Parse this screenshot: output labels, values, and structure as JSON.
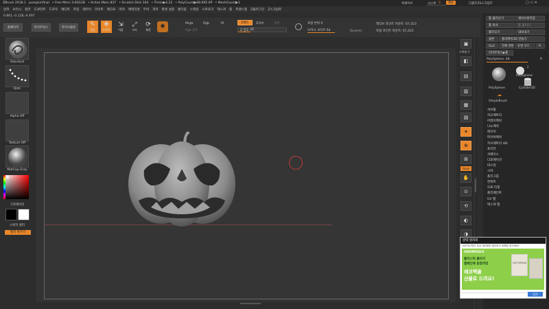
{
  "titlebar": {
    "app": "ZBrush 2018.1",
    "file": "pumpkinfinal",
    "free_mem": "• Free Mem 3.601GB",
    "active_mem": "• Active Mem 837",
    "scratch": "• Scratch Disk 164",
    "timer": "• Timer▶4.22",
    "polycount": "• PolyCount▶68.692 KP",
    "meshcount": "• MeshCount▶1",
    "right_items": [
      "퀵세이브",
      "시스루",
      "메뉴",
      "디폴트ZS스크립트"
    ],
    "seethrough_value": "0"
  },
  "menu": [
    "알파",
    "브러시",
    "컬러",
    "도큐먼트",
    "드로우",
    "에디트",
    "파일",
    "레이어",
    "라이트",
    "매크로",
    "마커",
    "매테리얼",
    "무비",
    "피커",
    "환경 설정",
    "렌더링",
    "스텐실",
    "스트로크",
    "텍스쳐",
    "툴",
    "트랜스폼",
    "Z플러그인",
    "Z스크립트"
  ],
  "coords": "0.861,-0.128,-0.497",
  "toolbar": {
    "home": "홈페이지",
    "lightbox": "라이트박스",
    "livebool": "라이브불린",
    "tools": [
      {
        "label": "편집",
        "icon": "edit-icon",
        "glyph": "✎"
      },
      {
        "label": "드로우",
        "icon": "draw-icon",
        "glyph": "✥"
      },
      {
        "label": "이동",
        "icon": "move-icon",
        "glyph": "⇲"
      },
      {
        "label": "크기",
        "icon": "scale-icon",
        "glyph": "⤢"
      },
      {
        "label": "회전",
        "icon": "rotate-icon",
        "glyph": "⟳"
      }
    ],
    "mrgb": "Mrgb",
    "rgb": "Rgb",
    "m": "M",
    "rgb_intensity": "Rgb 강도",
    "zadd": "Z애드",
    "zsub": "Z서브",
    "zcut": "Z컷",
    "z_intensity_label": "Z 강도",
    "z_intensity": "25",
    "focal_label": "포컬 변위",
    "focal": "0",
    "draw_size_label": "브러시 사이즈",
    "draw_size": "64",
    "dynamic": "Dynamic",
    "active_points": "액티브 포인트 카운트: 67,423",
    "total_points": "토탈 포인트 카운트: 67,423"
  },
  "leftshelf": {
    "brush": "Standard",
    "stroke": "Dots",
    "alpha": "Alpha Off",
    "texture": "Texture Off",
    "material": "MatCap Gray",
    "gradient": "그라데이션",
    "switch_color": "스위치 컬러",
    "alternate": "컬러 바꾸기"
  },
  "rightshelf": {
    "spix_label": "스픽셀",
    "spix_value": "3",
    "buttons": [
      {
        "name": "bpr-icon",
        "glyph": "▣"
      },
      {
        "name": "dynamic-icon",
        "glyph": "◧"
      },
      {
        "name": "actual-icon",
        "glyph": "▤"
      },
      {
        "name": "aahalf-icon",
        "glyph": "▥"
      },
      {
        "name": "persp-icon",
        "glyph": "▦"
      },
      {
        "name": "floor-icon",
        "glyph": "▧"
      },
      {
        "name": "local-icon",
        "glyph": "✦"
      },
      {
        "name": "xyz-icon",
        "glyph": "⊕"
      },
      {
        "name": "frame-icon",
        "glyph": "⊞"
      },
      {
        "name": "move-view-icon",
        "glyph": "✋"
      },
      {
        "name": "zoom-view-icon",
        "glyph": "⊙"
      },
      {
        "name": "rotate-view-icon",
        "glyph": "⟲"
      },
      {
        "name": "transp-icon",
        "glyph": "◐"
      },
      {
        "name": "ghost-icon",
        "glyph": "◑"
      },
      {
        "name": "solo-icon",
        "glyph": "●"
      },
      {
        "name": "xpose-icon",
        "glyph": "✸"
      }
    ],
    "xyz_label": "Gxyz"
  },
  "palette": {
    "row1": [
      "툴 불러오기",
      "세이브로저장"
    ],
    "row2": [
      "툴 복사",
      "툴 붙이기"
    ],
    "row3": [
      "불러오기",
      "내보내기"
    ],
    "row4": [
      "클론",
      "폴리메쉬3D 만들기"
    ],
    "row5": [
      "Go2",
      "전체 변환",
      "유변 모드",
      "R"
    ],
    "lightbox_tools": "라이트박스▶툴",
    "current_tool": "PolySphere. 48",
    "r": "R",
    "tools": [
      "PolySphere",
      "PolySphere",
      "Cylinder3D",
      "SimpleBrush"
    ],
    "count": "2",
    "subpalettes": [
      "서브툴",
      "지오메트리",
      "어레이메쉬",
      "나노메쉬",
      "레이어",
      "파이버메쉬",
      "지오메트리 HD",
      "프리뷰",
      "서페이스",
      "디포메이션",
      "마스킹",
      "시야",
      "폴리그룹",
      "컨택트",
      "모프 타겟",
      "폴리페인트",
      "UV 맵",
      "텍스쳐 맵"
    ]
  },
  "ad": {
    "header": "알약 알리미",
    "subtitle": "NOTE(개인) 무상 개인정보 갱신하고 공짜로 받으세요!",
    "brand": "GREENPEACE",
    "line1": "플라스틱 줄이기",
    "line2": "캠페인에 동참하면",
    "line3": "에코백을",
    "line4": "선물로 드려요!",
    "bag_text": "CAFE BRAND",
    "button": "닫기"
  },
  "colors": {
    "accent": "#e8862a",
    "bg": "#2d2d2d",
    "canvas": "#353535"
  }
}
